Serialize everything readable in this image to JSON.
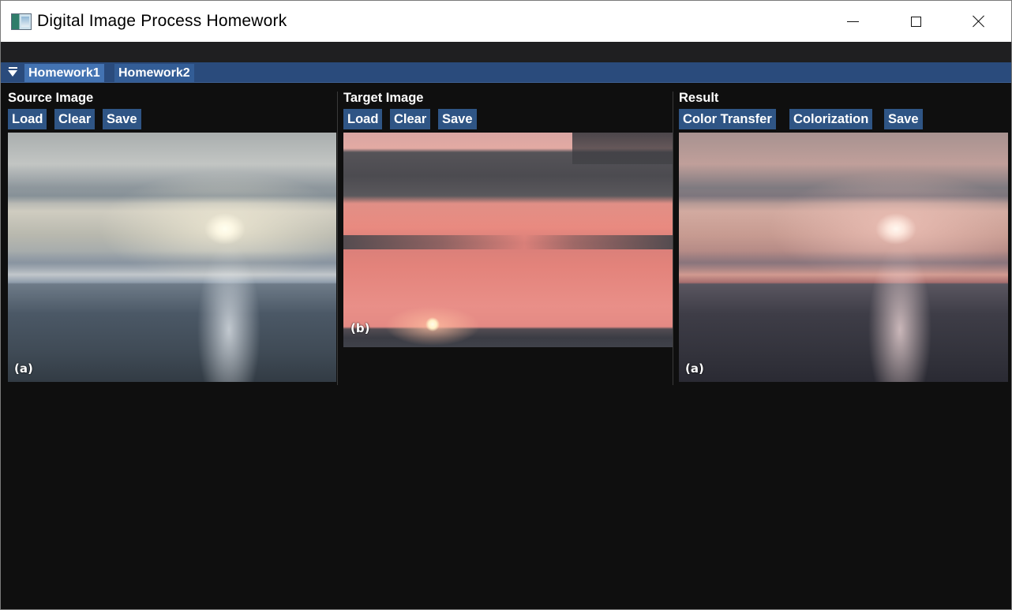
{
  "window": {
    "title": "Digital Image Process Homework",
    "icon": "app-icon",
    "controls": [
      "minimize-icon",
      "maximize-icon",
      "close-icon"
    ]
  },
  "tabs": [
    {
      "label": "Homework1",
      "active": true
    },
    {
      "label": "Homework2",
      "active": false
    }
  ],
  "panels": {
    "source": {
      "title": "Source Image",
      "buttons": [
        "Load",
        "Clear",
        "Save"
      ],
      "image_label": "(a)"
    },
    "target": {
      "title": "Target Image",
      "buttons": [
        "Load",
        "Clear",
        "Save"
      ],
      "image_label": "(b)"
    },
    "result": {
      "title": "Result",
      "buttons": [
        "Color Transfer",
        "Colorization",
        "Save"
      ],
      "image_label": "(a)"
    }
  },
  "colors": {
    "tab_bar": "#2a4b7c",
    "tab_active": "#4373b2",
    "button": "#2f5585",
    "background": "#0f0f0f"
  }
}
